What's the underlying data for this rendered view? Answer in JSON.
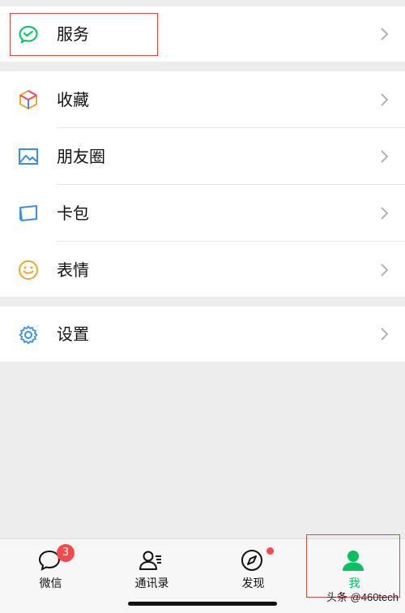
{
  "menu": {
    "services": {
      "label": "服务",
      "icon": "wechat-pay-icon"
    },
    "group2": [
      {
        "label": "收藏",
        "icon": "cube-icon"
      },
      {
        "label": "朋友圈",
        "icon": "image-icon"
      },
      {
        "label": "卡包",
        "icon": "card-icon"
      },
      {
        "label": "表情",
        "icon": "smiley-icon"
      }
    ],
    "settings": {
      "label": "设置",
      "icon": "gear-icon"
    }
  },
  "tabbar": {
    "tabs": [
      {
        "label": "微信",
        "icon": "chat-bubble-icon",
        "badge": "3"
      },
      {
        "label": "通讯录",
        "icon": "contacts-icon"
      },
      {
        "label": "发现",
        "icon": "compass-icon",
        "dot": true
      },
      {
        "label": "我",
        "icon": "person-icon",
        "active": true
      }
    ]
  },
  "watermark": "头条 @460tech",
  "colors": {
    "accent": "#07c160",
    "badge": "#f5494c",
    "annotation": "#e0454a",
    "background": "#ededed"
  }
}
